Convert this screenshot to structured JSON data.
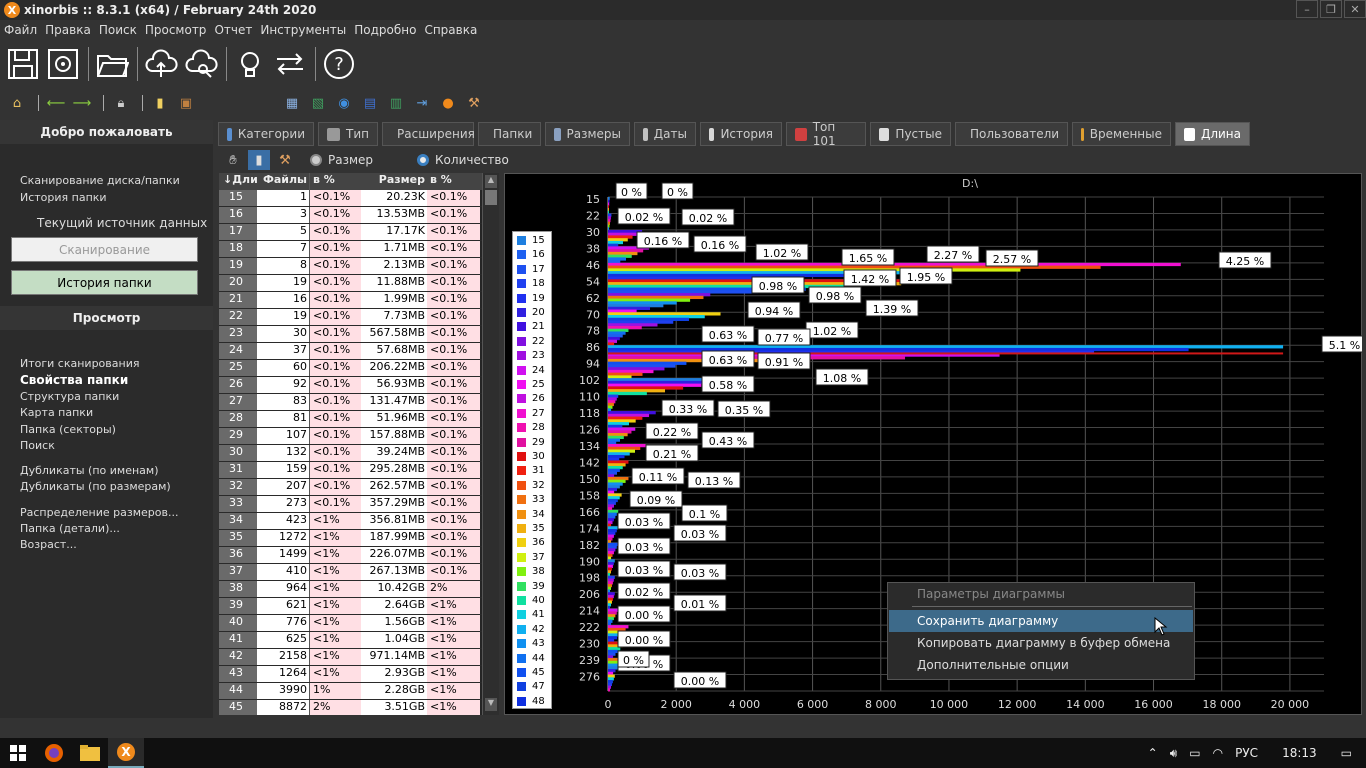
{
  "window": {
    "title": "xinorbis :: 8.3.1 (x64) / February 24th 2020",
    "logo_letter": "X",
    "controls": [
      "–",
      "❐",
      "✕"
    ]
  },
  "menu": [
    "Файл",
    "Правка",
    "Поиск",
    "Просмотр",
    "Отчет",
    "Инструменты",
    "Подробно",
    "Справка"
  ],
  "left": {
    "welcome": "Добро пожаловать",
    "scan_link": "Сканирование диска/папки",
    "history_link": "История папки",
    "source_label": "Текущий источник данных",
    "btn_scan": "Сканирование",
    "btn_history": "История папки",
    "view_header": "Просмотр",
    "view_links": [
      "Итоги сканирования",
      "Свойства папки",
      "Структура папки",
      "Карта папки",
      "Папка (секторы)",
      "Поиск",
      "Дубликаты (по именам)",
      "Дубликаты (по размерам)",
      "Распределение размеров...",
      "Папка (детали)...",
      "Возраст..."
    ]
  },
  "tabs": [
    "Категории",
    "Тип",
    "Расширения",
    "Папки",
    "Размеры",
    "Даты",
    "История",
    "Топ 101",
    "Пустые",
    "Пользователи",
    "Временные",
    "Длина"
  ],
  "tab_colors": [
    "#5a8fd0",
    "#999",
    "#e8b020",
    "#e8c040",
    "#8aa0c0",
    "#c0c0c0",
    "#d8d8d8",
    "#d04040",
    "#ddd",
    "#5080c0",
    "#e0a030",
    "#fff"
  ],
  "subbar": {
    "radio_size": "Размер",
    "radio_count": "Количество"
  },
  "table": {
    "headers": [
      "↓Дли",
      "Файлы",
      "в %",
      "Размер",
      "в %"
    ],
    "rows": [
      [
        "15",
        "1",
        "<0.1%",
        "20.23K",
        "<0.1%"
      ],
      [
        "16",
        "3",
        "<0.1%",
        "13.53MB",
        "<0.1%"
      ],
      [
        "17",
        "5",
        "<0.1%",
        "17.17K",
        "<0.1%"
      ],
      [
        "18",
        "7",
        "<0.1%",
        "1.71MB",
        "<0.1%"
      ],
      [
        "19",
        "8",
        "<0.1%",
        "2.13MB",
        "<0.1%"
      ],
      [
        "20",
        "19",
        "<0.1%",
        "11.88MB",
        "<0.1%"
      ],
      [
        "21",
        "16",
        "<0.1%",
        "1.99MB",
        "<0.1%"
      ],
      [
        "22",
        "19",
        "<0.1%",
        "7.73MB",
        "<0.1%"
      ],
      [
        "23",
        "30",
        "<0.1%",
        "567.58MB",
        "<0.1%"
      ],
      [
        "24",
        "37",
        "<0.1%",
        "57.68MB",
        "<0.1%"
      ],
      [
        "25",
        "60",
        "<0.1%",
        "206.22MB",
        "<0.1%"
      ],
      [
        "26",
        "92",
        "<0.1%",
        "56.93MB",
        "<0.1%"
      ],
      [
        "27",
        "83",
        "<0.1%",
        "131.47MB",
        "<0.1%"
      ],
      [
        "28",
        "81",
        "<0.1%",
        "51.96MB",
        "<0.1%"
      ],
      [
        "29",
        "107",
        "<0.1%",
        "157.88MB",
        "<0.1%"
      ],
      [
        "30",
        "132",
        "<0.1%",
        "39.24MB",
        "<0.1%"
      ],
      [
        "31",
        "159",
        "<0.1%",
        "295.28MB",
        "<0.1%"
      ],
      [
        "32",
        "207",
        "<0.1%",
        "262.57MB",
        "<0.1%"
      ],
      [
        "33",
        "273",
        "<0.1%",
        "357.29MB",
        "<0.1%"
      ],
      [
        "34",
        "423",
        "<1%",
        "356.81MB",
        "<0.1%"
      ],
      [
        "35",
        "1272",
        "<1%",
        "187.99MB",
        "<0.1%"
      ],
      [
        "36",
        "1499",
        "<1%",
        "226.07MB",
        "<0.1%"
      ],
      [
        "37",
        "410",
        "<1%",
        "267.13MB",
        "<0.1%"
      ],
      [
        "38",
        "964",
        "<1%",
        "10.42GB",
        "2%"
      ],
      [
        "39",
        "621",
        "<1%",
        "2.64GB",
        "<1%"
      ],
      [
        "40",
        "776",
        "<1%",
        "1.56GB",
        "<1%"
      ],
      [
        "41",
        "625",
        "<1%",
        "1.04GB",
        "<1%"
      ],
      [
        "42",
        "2158",
        "<1%",
        "971.14MB",
        "<1%"
      ],
      [
        "43",
        "1264",
        "<1%",
        "2.93GB",
        "<1%"
      ],
      [
        "44",
        "3990",
        "1%",
        "2.28GB",
        "<1%"
      ],
      [
        "45",
        "8872",
        "2%",
        "3.51GB",
        "<1%"
      ]
    ]
  },
  "chart_data": {
    "type": "bar",
    "title": "D:\\",
    "y_categories": [
      "15",
      "22",
      "30",
      "38",
      "46",
      "54",
      "62",
      "70",
      "78",
      "86",
      "94",
      "102",
      "110",
      "118",
      "126",
      "134",
      "142",
      "150",
      "158",
      "166",
      "174",
      "182",
      "190",
      "198",
      "206",
      "214",
      "222",
      "230",
      "239",
      "276"
    ],
    "x_ticks": [
      "0",
      "2 000",
      "4 000",
      "6 000",
      "8 000",
      "10 000",
      "12 000",
      "14 000",
      "16 000",
      "18 000",
      "20 000"
    ],
    "xlim": [
      0,
      21000
    ],
    "legend": [
      "15",
      "16",
      "17",
      "18",
      "19",
      "20",
      "21",
      "22",
      "23",
      "24",
      "25",
      "26",
      "27",
      "28",
      "29",
      "30",
      "31",
      "32",
      "33",
      "34",
      "35",
      "36",
      "37",
      "38",
      "39",
      "40",
      "41",
      "42",
      "43",
      "44",
      "45",
      "47",
      "48"
    ],
    "legend_colors": [
      "#1e7fe0",
      "#1e60f0",
      "#1e50f0",
      "#2040f0",
      "#2030f0",
      "#3020e0",
      "#4010e0",
      "#8010e0",
      "#a010e0",
      "#d010f0",
      "#f010f0",
      "#c010e0",
      "#f010d0",
      "#f010b0",
      "#e010a0",
      "#e01010",
      "#f02010",
      "#f05010",
      "#f07010",
      "#f09010",
      "#f0b010",
      "#f0d010",
      "#d0f010",
      "#80f010",
      "#30e060",
      "#10e0a0",
      "#10d0e0",
      "#10b0f0",
      "#1090f0",
      "#1070f0",
      "#1050f0",
      "#1040e0",
      "#1030e0"
    ],
    "approx_max_values": [
      50,
      100,
      1000,
      1200,
      16800,
      10000,
      2800,
      3300,
      600,
      19800,
      2300,
      3800,
      300,
      1400,
      800,
      1100,
      600,
      600,
      400,
      300,
      300,
      300,
      200,
      200,
      200,
      300,
      600,
      500,
      500,
      200
    ],
    "bar_labels": [
      "0 %",
      "0 %",
      "0.02 %",
      "0.02 %",
      "0.16 %",
      "0.16 %",
      "1.02 %",
      "1.65 %",
      "2.27 %",
      "2.57 %",
      "4.25 %",
      "1.42 %",
      "1.95 %",
      "0.98 %",
      "0.98 %",
      "0.94 %",
      "1.39 %",
      "1.02 %",
      "0.63 %",
      "0.77 %",
      "5.1 %",
      "0.63 %",
      "0.91 %",
      "1.08 %",
      "0.58 %",
      "0.33 %",
      "0.35 %",
      "0.22 %",
      "0.43 %",
      "0.21 %",
      "0.11 %",
      "0.13 %",
      "0.09 %",
      "0.1 %",
      "0.03 %",
      "0.03 %",
      "0.03 %",
      "0.03 %",
      "0.03 %",
      "0.02 %",
      "0.01 %",
      "0.00 %",
      "0.00 %",
      "0.00 %",
      "0.00 %",
      "0 %"
    ]
  },
  "context_menu": {
    "header": "Параметры диаграммы",
    "items": [
      "Сохранить диаграмму",
      "Копировать диаграмму в буфер обмена",
      "Дополнительные опции"
    ]
  },
  "taskbar": {
    "lang": "РУС",
    "time": "18:13"
  }
}
